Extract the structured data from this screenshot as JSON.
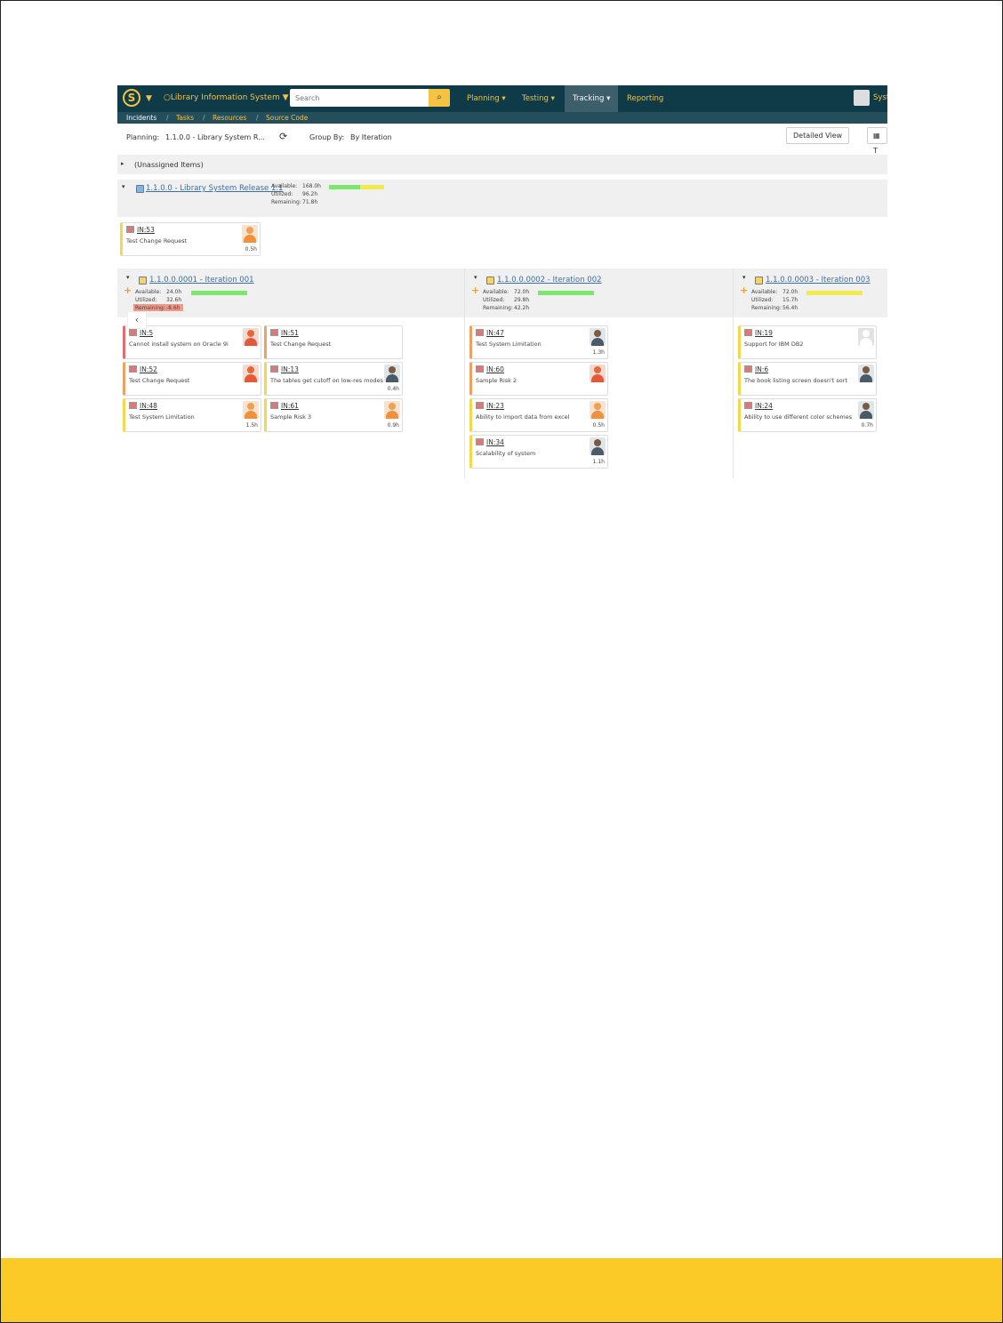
{
  "header": {
    "logo_letter": "S",
    "project": "Library Information System",
    "search_placeholder": "Search",
    "menus": [
      {
        "label": "Planning",
        "caret": "▾"
      },
      {
        "label": "Testing",
        "caret": "▾"
      },
      {
        "label": "Tracking",
        "caret": "▾",
        "active": true
      },
      {
        "label": "Reporting"
      }
    ],
    "user_label": "Syst"
  },
  "subnav": [
    "Incidents",
    "Tasks",
    "Resources",
    "Source Code"
  ],
  "subnav_sep": "/",
  "toolbar": {
    "planning_label": "Planning:",
    "planning_value": "1.1.0.0 - Library System R...",
    "group_label": "Group By:",
    "group_value": "By Iteration",
    "detailed_view": "Detailed View",
    "table_label": "T"
  },
  "unassigned": {
    "label": "(Unassigned Items)"
  },
  "release": {
    "name": "1.1.0.0 - Library System Release 1.1",
    "stats": [
      {
        "label": "Available:",
        "value": "168.0h"
      },
      {
        "label": "Utilized:",
        "value": "96.2h"
      },
      {
        "label": "Remaining:",
        "value": "71.8h"
      }
    ],
    "utilization_fraction": 0.57
  },
  "release_cards": [
    {
      "id": "IN:53",
      "name": "Test Change Request",
      "hours": "0.5h",
      "color": "yellow",
      "avatar": "orange"
    }
  ],
  "iterations": [
    {
      "name": "1.1.0.0.0001 - Iteration 001",
      "stats": [
        {
          "label": "Available:",
          "value": "24.0h"
        },
        {
          "label": "Utilized:",
          "value": "32.6h"
        },
        {
          "label": "Remaining:",
          "value": "-8.6h"
        }
      ],
      "cards": [
        {
          "id": "IN:5",
          "name": "Cannot install system on Oracle 9i",
          "hours": "",
          "color": "red",
          "avatar": "redhair"
        },
        {
          "id": "IN:51",
          "name": "Test Change Request",
          "hours": "",
          "color": "orange",
          "avatar": "none"
        },
        {
          "id": "IN:52",
          "name": "Test Change Request",
          "hours": "",
          "color": "orange",
          "avatar": "redhair"
        },
        {
          "id": "IN:13",
          "name": "The tables get cutoff on low-res modes",
          "hours": "0.4h",
          "color": "yellow",
          "avatar": "suit"
        },
        {
          "id": "IN:48",
          "name": "Test System Limitation",
          "hours": "1.5h",
          "color": "yellow",
          "avatar": "orange"
        },
        {
          "id": "IN:61",
          "name": "Sample Risk 3",
          "hours": "0.9h",
          "color": "yellow",
          "avatar": "orange"
        }
      ]
    },
    {
      "name": "1.1.0.0.0002 - Iteration 002",
      "stats": [
        {
          "label": "Available:",
          "value": "72.0h"
        },
        {
          "label": "Utilized:",
          "value": "29.8h"
        },
        {
          "label": "Remaining:",
          "value": "42.2h"
        }
      ],
      "cards": [
        {
          "id": "IN:47",
          "name": "Test System Limitation",
          "hours": "1.3h",
          "color": "orange",
          "avatar": "suit"
        },
        {
          "id": "IN:60",
          "name": "Sample Risk 2",
          "hours": "",
          "color": "orange",
          "avatar": "redhair"
        },
        {
          "id": "IN:23",
          "name": "Ability to import data from excel",
          "hours": "0.5h",
          "color": "yellow",
          "avatar": "orange"
        },
        {
          "id": "IN:34",
          "name": "Scalability of system",
          "hours": "1.1h",
          "color": "yellow",
          "avatar": "suit"
        }
      ]
    },
    {
      "name": "1.1.0.0.0003 - Iteration 003",
      "stats": [
        {
          "label": "Available:",
          "value": "72.0h"
        },
        {
          "label": "Utilized:",
          "value": "15.7h"
        },
        {
          "label": "Remaining:",
          "value": "56.4h"
        }
      ],
      "cards": [
        {
          "id": "IN:19",
          "name": "Support for IBM DB2",
          "hours": "",
          "color": "yellow",
          "avatar": "blank"
        },
        {
          "id": "IN:6",
          "name": "The book listing screen doesn't sort",
          "hours": "",
          "color": "yellow",
          "avatar": "suit"
        },
        {
          "id": "IN:24",
          "name": "Ability to use different color schemes",
          "hours": "0.7h",
          "color": "yellow",
          "avatar": "suit"
        }
      ]
    }
  ],
  "colors": {
    "navbar": "#0f3a48",
    "accent": "#f5c342",
    "footer_band": "#fbca27",
    "bar_green": "#7de66d",
    "bar_yellow": "#f2ea4a",
    "negative": "#f09a8a"
  },
  "icons": {
    "refresh": "⟳",
    "search": "⌕",
    "expand": "▾",
    "collapsed": "▸",
    "add": "+",
    "collapse_left": "‹",
    "grid": "▦"
  }
}
